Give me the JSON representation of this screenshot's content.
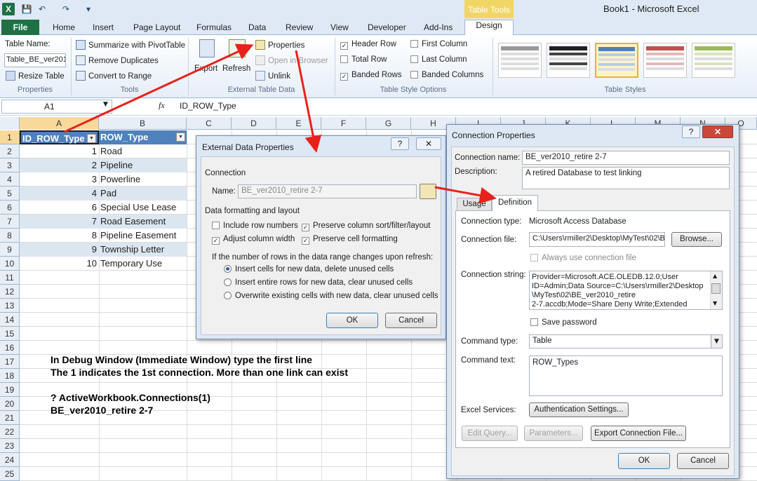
{
  "app": {
    "title": "Book1  -  Microsoft Excel",
    "icon": "excel-icon",
    "contextual_tab": "Table Tools"
  },
  "quick_access": [
    "save-icon",
    "undo-icon",
    "redo-icon",
    "customize-icon"
  ],
  "tabs": [
    "File",
    "Home",
    "Insert",
    "Page Layout",
    "Formulas",
    "Data",
    "Review",
    "View",
    "Developer",
    "Add-Ins",
    "Design"
  ],
  "ribbon": {
    "properties_group": {
      "table_name_label": "Table Name:",
      "table_name_value": "Table_BE_ver201",
      "resize": "Resize Table",
      "label": "Properties"
    },
    "tools_group": {
      "summarize": "Summarize with PivotTable",
      "remove_dup": "Remove Duplicates",
      "convert": "Convert to Range",
      "label": "Tools"
    },
    "external_group": {
      "export": "Export",
      "refresh": "Refresh",
      "properties": "Properties",
      "open_browser": "Open in Browser",
      "unlink": "Unlink",
      "label": "External Table Data"
    },
    "style_options": {
      "header_row": "Header Row",
      "total_row": "Total Row",
      "banded_rows": "Banded Rows",
      "first_column": "First Column",
      "last_column": "Last Column",
      "banded_columns": "Banded Columns",
      "label": "Table Style Options"
    },
    "styles_label": "Table Styles",
    "style_colors": [
      "#222222",
      "#222222",
      "#4f81bd",
      "#c0504d",
      "#9bbb59"
    ]
  },
  "formula_bar": {
    "name_box": "A1",
    "fx": "fx",
    "content": "ID_ROW_Type"
  },
  "sheet": {
    "columns": [
      "A",
      "B",
      "C",
      "D",
      "E",
      "F",
      "G",
      "H",
      "I",
      "J",
      "K",
      "L",
      "M",
      "N",
      "O"
    ],
    "rows": [
      "1",
      "2",
      "3",
      "4",
      "5",
      "6",
      "7",
      "8",
      "9",
      "10",
      "11",
      "12",
      "13",
      "14",
      "15",
      "16",
      "17",
      "18",
      "19",
      "20",
      "21",
      "22",
      "23",
      "24",
      "25"
    ],
    "header": [
      "ID_ROW_Type",
      "ROW_Type"
    ],
    "data": [
      [
        "1",
        "Road"
      ],
      [
        "2",
        "Pipeline"
      ],
      [
        "3",
        "Powerline"
      ],
      [
        "4",
        "Pad"
      ],
      [
        "6",
        "Special Use Lease"
      ],
      [
        "7",
        "Road Easement"
      ],
      [
        "8",
        "Pipeline Easement"
      ],
      [
        "9",
        "Township Letter"
      ],
      [
        "10",
        "Temporary Use"
      ]
    ],
    "note_lines": [
      "In Debug Window (Immediate Window) type the first line",
      "The 1 indicates the 1st connection. More than one link can exist",
      "",
      "? ActiveWorkbook.Connections(1)",
      "BE_ver2010_retire 2-7"
    ]
  },
  "external_dialog": {
    "title": "External Data Properties",
    "help": "?",
    "close": "✕",
    "connection_label": "Connection",
    "name_label": "Name:",
    "name_value": "BE_ver2010_retire 2-7",
    "formatting_label": "Data formatting and layout",
    "include_row_numbers": "Include row numbers",
    "adjust_width": "Adjust column width",
    "preserve_sort": "Preserve column sort/filter/layout",
    "preserve_format": "Preserve cell formatting",
    "refresh_label": "If the number of rows in the data range changes upon refresh:",
    "opt1": "Insert cells for new data, delete unused cells",
    "opt2": "Insert entire rows for new data, clear unused cells",
    "opt3": "Overwrite existing cells with new data, clear unused cells",
    "ok": "OK",
    "cancel": "Cancel"
  },
  "connection_dialog": {
    "title": "Connection Properties",
    "help": "?",
    "close": "✕",
    "name_label": "Connection name:",
    "name_value": "BE_ver2010_retire 2-7",
    "desc_label": "Description:",
    "desc_value": "A retired Database to test linking",
    "tab_usage": "Usage",
    "tab_definition": "Definition",
    "type_label": "Connection type:",
    "type_value": "Microsoft Access Database",
    "file_label": "Connection file:",
    "file_value": "C:\\Users\\rmiller2\\Desktop\\MyTest\\02\\B",
    "browse": "Browse...",
    "always_use": "Always use connection file",
    "string_label": "Connection string:",
    "string_lines": [
      "Provider=Microsoft.ACE.OLEDB.12.0;User",
      "ID=Admin;Data Source=C:\\Users\\rmiller2\\Desktop",
      "\\MyTest\\02\\BE_ver2010_retire",
      "2-7.accdb;Mode=Share Deny Write;Extended"
    ],
    "save_password": "Save password",
    "cmdtype_label": "Command type:",
    "cmdtype_value": "Table",
    "cmdtext_label": "Command text:",
    "cmdtext_value": "ROW_Types",
    "services_label": "Excel Services:",
    "auth": "Authentication Settings...",
    "edit_query": "Edit Query...",
    "parameters": "Parameters...",
    "export_file": "Export Connection File...",
    "ok": "OK",
    "cancel": "Cancel"
  },
  "annotation_color": "#e8211b"
}
